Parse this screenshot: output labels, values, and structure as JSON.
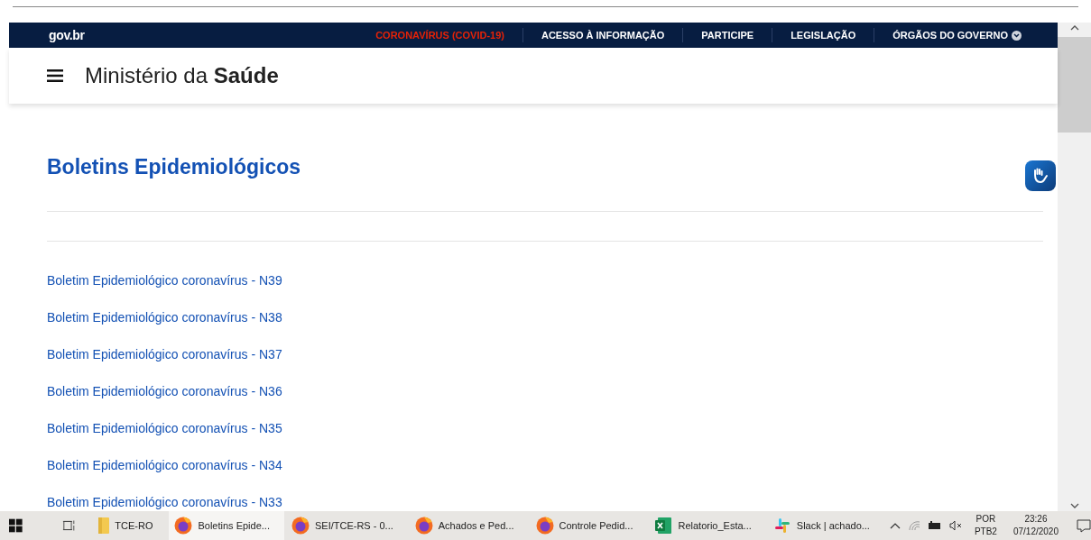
{
  "topbar": {
    "logo": "gov.br",
    "links": [
      {
        "label": "CORONAVÍRUS (COVID-19)",
        "kind": "alert"
      },
      {
        "label": "ACESSO À INFORMAÇÃO",
        "kind": "normal"
      },
      {
        "label": "PARTICIPE",
        "kind": "normal"
      },
      {
        "label": "LEGISLAÇÃO",
        "kind": "normal"
      },
      {
        "label": "ÓRGÃOS DO GOVERNO",
        "kind": "dropdown"
      }
    ]
  },
  "header": {
    "site_prefix": "Ministério da",
    "site_name": "Saúde"
  },
  "page": {
    "title": "Boletins Epidemiológicos",
    "links": [
      "Boletim Epidemiológico coronavírus - N39",
      "Boletim Epidemiológico coronavírus - N38",
      "Boletim Epidemiológico coronavírus - N37",
      "Boletim Epidemiológico coronavírus - N36",
      "Boletim Epidemiológico coronavírus - N35",
      "Boletim Epidemiológico coronavírus - N34",
      "Boletim Epidemiológico coronavírus - N33"
    ]
  },
  "taskbar": {
    "apps": [
      {
        "label": "TCE-RO",
        "kind": "folder",
        "selected": false
      },
      {
        "label": "Boletins Epide...",
        "kind": "firefox",
        "selected": true
      },
      {
        "label": "SEI/TCE-RS - 0...",
        "kind": "firefox",
        "selected": false
      },
      {
        "label": "Achados e Ped...",
        "kind": "firefox",
        "selected": false
      },
      {
        "label": "Controle Pedid...",
        "kind": "firefox",
        "selected": false
      },
      {
        "label": "Relatorio_Esta...",
        "kind": "excel",
        "selected": false
      },
      {
        "label": "Slack | achado...",
        "kind": "slack",
        "selected": false
      }
    ],
    "language": [
      "POR",
      "PTB2"
    ],
    "time": "23:26",
    "date": "07/12/2020"
  }
}
